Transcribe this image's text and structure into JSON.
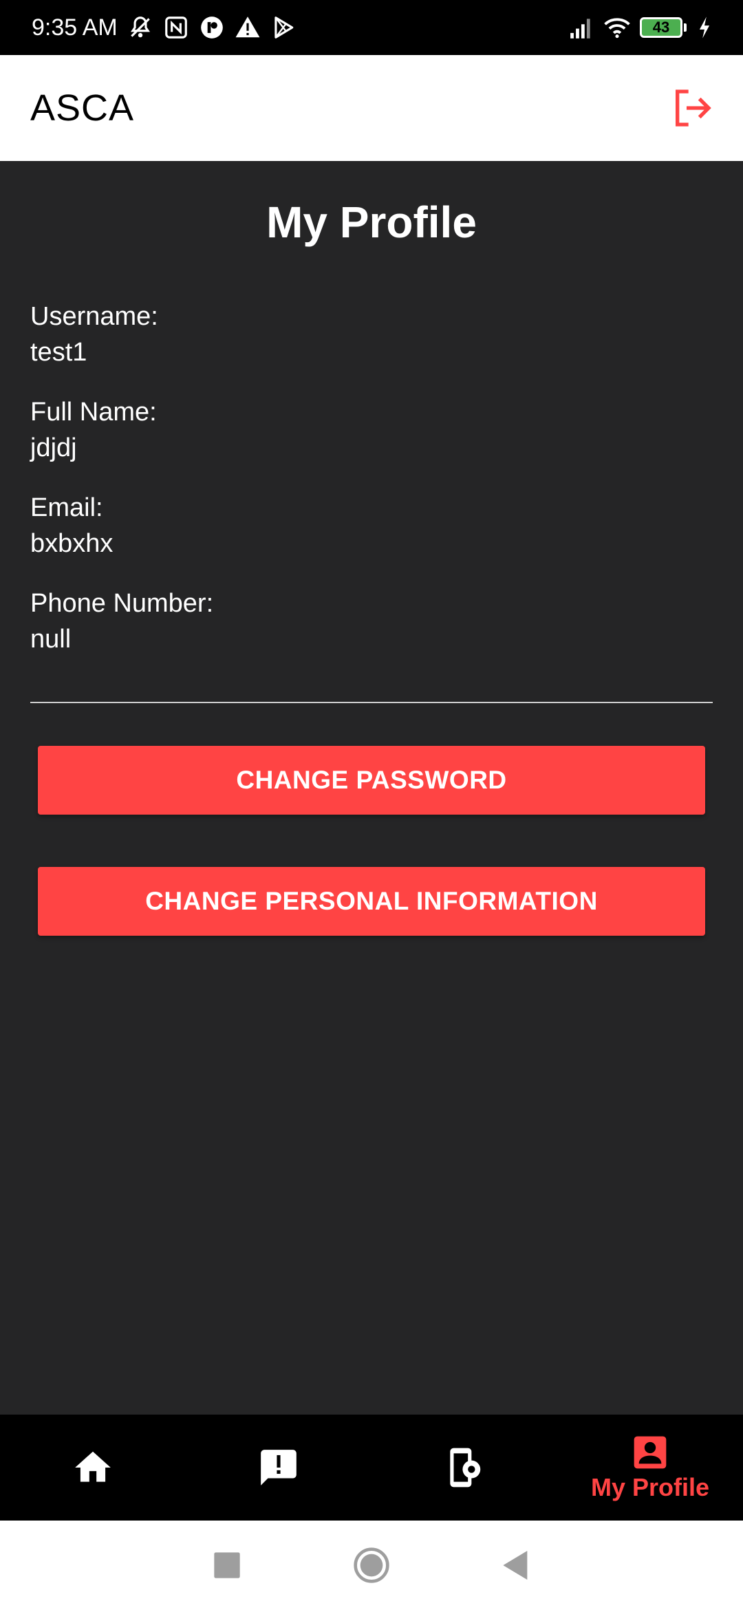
{
  "status_bar": {
    "time": "9:35 AM",
    "battery": "43",
    "left_icons": [
      "mute-bell-icon",
      "nfc-icon",
      "app-notification-icon",
      "warning-icon",
      "play-store-icon"
    ],
    "right_icons": [
      "signal-icon",
      "wifi-icon",
      "battery-icon",
      "charging-icon"
    ]
  },
  "app_bar": {
    "title": "ASCA",
    "logout_icon": "logout-icon"
  },
  "profile": {
    "title": "My Profile",
    "fields": [
      {
        "label": "Username:",
        "value": "test1"
      },
      {
        "label": "Full Name:",
        "value": "jdjdj"
      },
      {
        "label": "Email:",
        "value": "bxbxhx"
      },
      {
        "label": "Phone Number:",
        "value": "null"
      }
    ],
    "change_password_label": "CHANGE PASSWORD",
    "change_info_label": "CHANGE PERSONAL INFORMATION"
  },
  "bottom_nav": {
    "items": [
      {
        "icon": "home-icon",
        "label": ""
      },
      {
        "icon": "report-icon",
        "label": ""
      },
      {
        "icon": "device-settings-icon",
        "label": ""
      },
      {
        "icon": "profile-icon",
        "label": "My Profile",
        "active": true
      }
    ]
  },
  "colors": {
    "accent": "#ff4444",
    "background": "#252526",
    "app_bar": "#ffffff",
    "nav_bar": "#000000"
  }
}
